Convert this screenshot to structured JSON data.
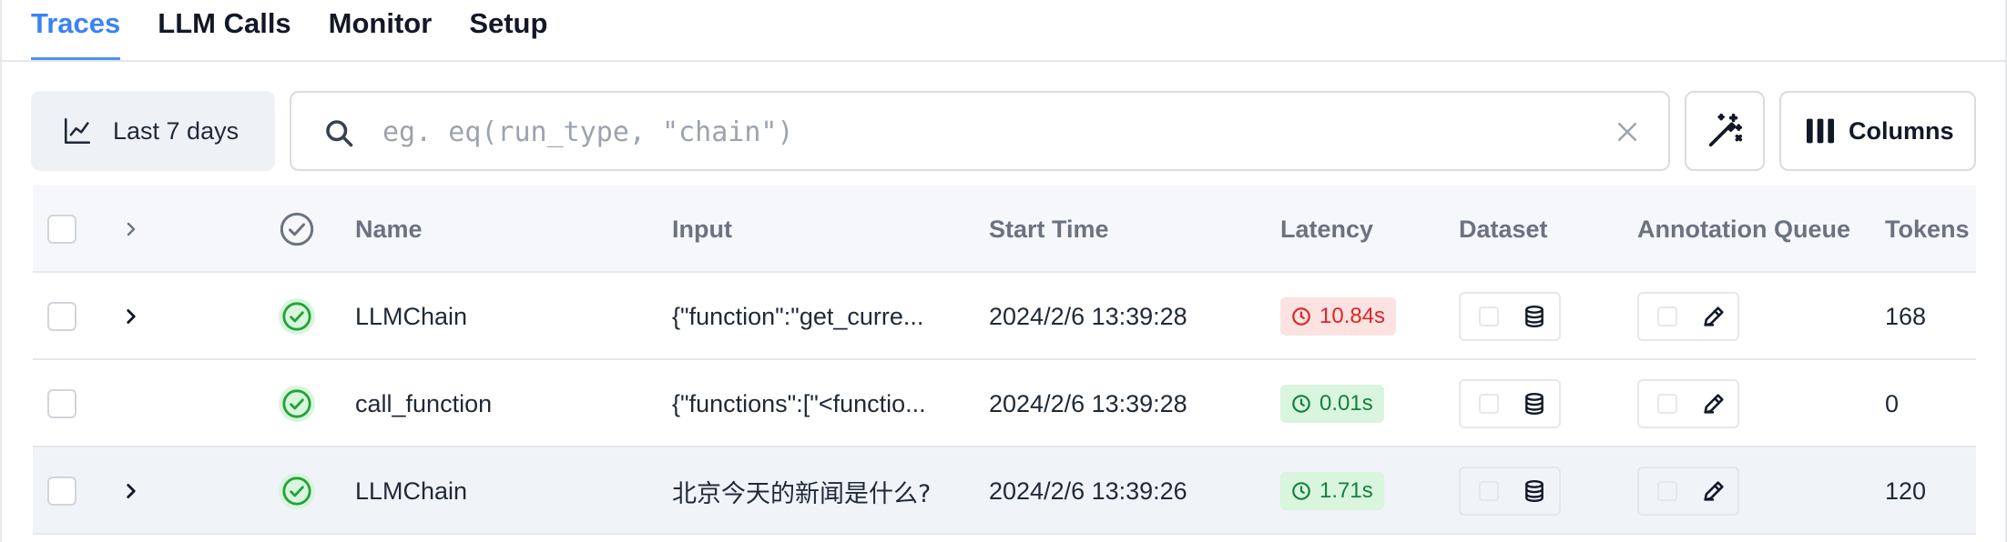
{
  "tabs": [
    {
      "label": "Traces",
      "active": true
    },
    {
      "label": "LLM Calls",
      "active": false
    },
    {
      "label": "Monitor",
      "active": false
    },
    {
      "label": "Setup",
      "active": false
    }
  ],
  "toolbar": {
    "range_label": "Last 7 days",
    "range_icon": "line-chart-icon",
    "search_placeholder": "eg. eq(run_type, \"chain\")",
    "search_value": "",
    "magic_icon": "magic-wand-icon",
    "columns_label": "Columns"
  },
  "table": {
    "headers": {
      "name": "Name",
      "input": "Input",
      "start_time": "Start Time",
      "latency": "Latency",
      "dataset": "Dataset",
      "annotation_queue": "Annotation Queue",
      "tokens": "Tokens"
    },
    "rows": [
      {
        "name": "LLMChain",
        "input": "{\"function\":\"get_curre...",
        "start_time": "2024/2/6 13:39:28",
        "latency": "10.84s",
        "latency_status": "slow",
        "tokens": "168",
        "expandable": true
      },
      {
        "name": "call_function",
        "input": "{\"functions\":[\"<functio...",
        "start_time": "2024/2/6 13:39:28",
        "latency": "0.01s",
        "latency_status": "fast",
        "tokens": "0",
        "expandable": false
      },
      {
        "name": "LLMChain",
        "input": "北京今天的新闻是什么?",
        "start_time": "2024/2/6 13:39:26",
        "latency": "1.71s",
        "latency_status": "fast",
        "tokens": "120",
        "expandable": true
      }
    ]
  },
  "colors": {
    "accent": "#3b82f6",
    "success": "#22a33a",
    "latency_slow_bg": "#fde2e2",
    "latency_slow_fg": "#dc2626",
    "latency_fast_bg": "#d9f5dd",
    "latency_fast_fg": "#15803d"
  }
}
